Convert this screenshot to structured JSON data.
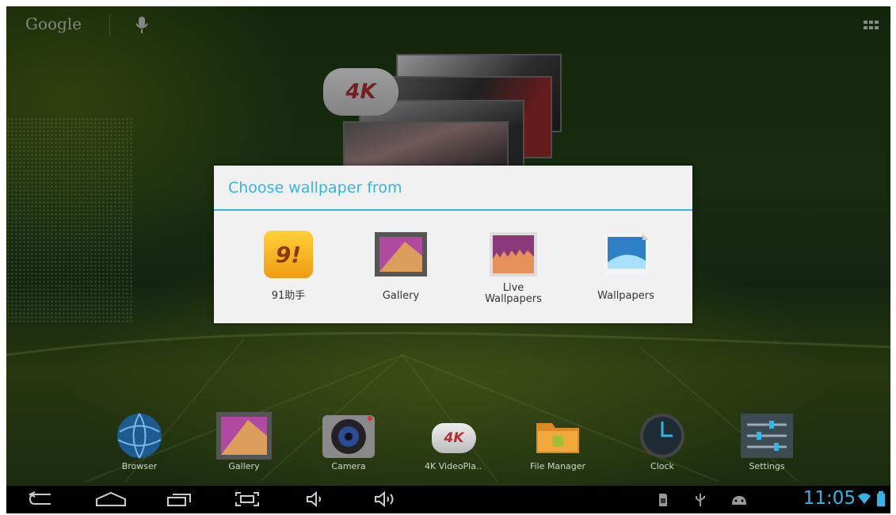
{
  "topbar": {
    "google_label": "Google"
  },
  "widget": {
    "badge": "4K"
  },
  "dialog": {
    "title": "Choose wallpaper from",
    "options": [
      {
        "label": "91助手",
        "icon": "91-assistant-icon"
      },
      {
        "label": "Gallery",
        "icon": "gallery-icon"
      },
      {
        "label_line1": "Live",
        "label_line2": "Wallpapers",
        "icon": "live-wallpapers-icon"
      },
      {
        "label": "Wallpapers",
        "icon": "wallpapers-icon"
      }
    ]
  },
  "dock": [
    {
      "label": "Browser"
    },
    {
      "label": "Gallery"
    },
    {
      "label": "Camera"
    },
    {
      "label": "4K VideoPla..",
      "badge": "4K"
    },
    {
      "label": "File Manager"
    },
    {
      "label": "Clock"
    },
    {
      "label": "Settings"
    }
  ],
  "statusbar": {
    "time": "11:05"
  },
  "colors": {
    "accent": "#33b5e5",
    "navbar": "#000000",
    "dialog_bg": "#f1f1f1"
  }
}
